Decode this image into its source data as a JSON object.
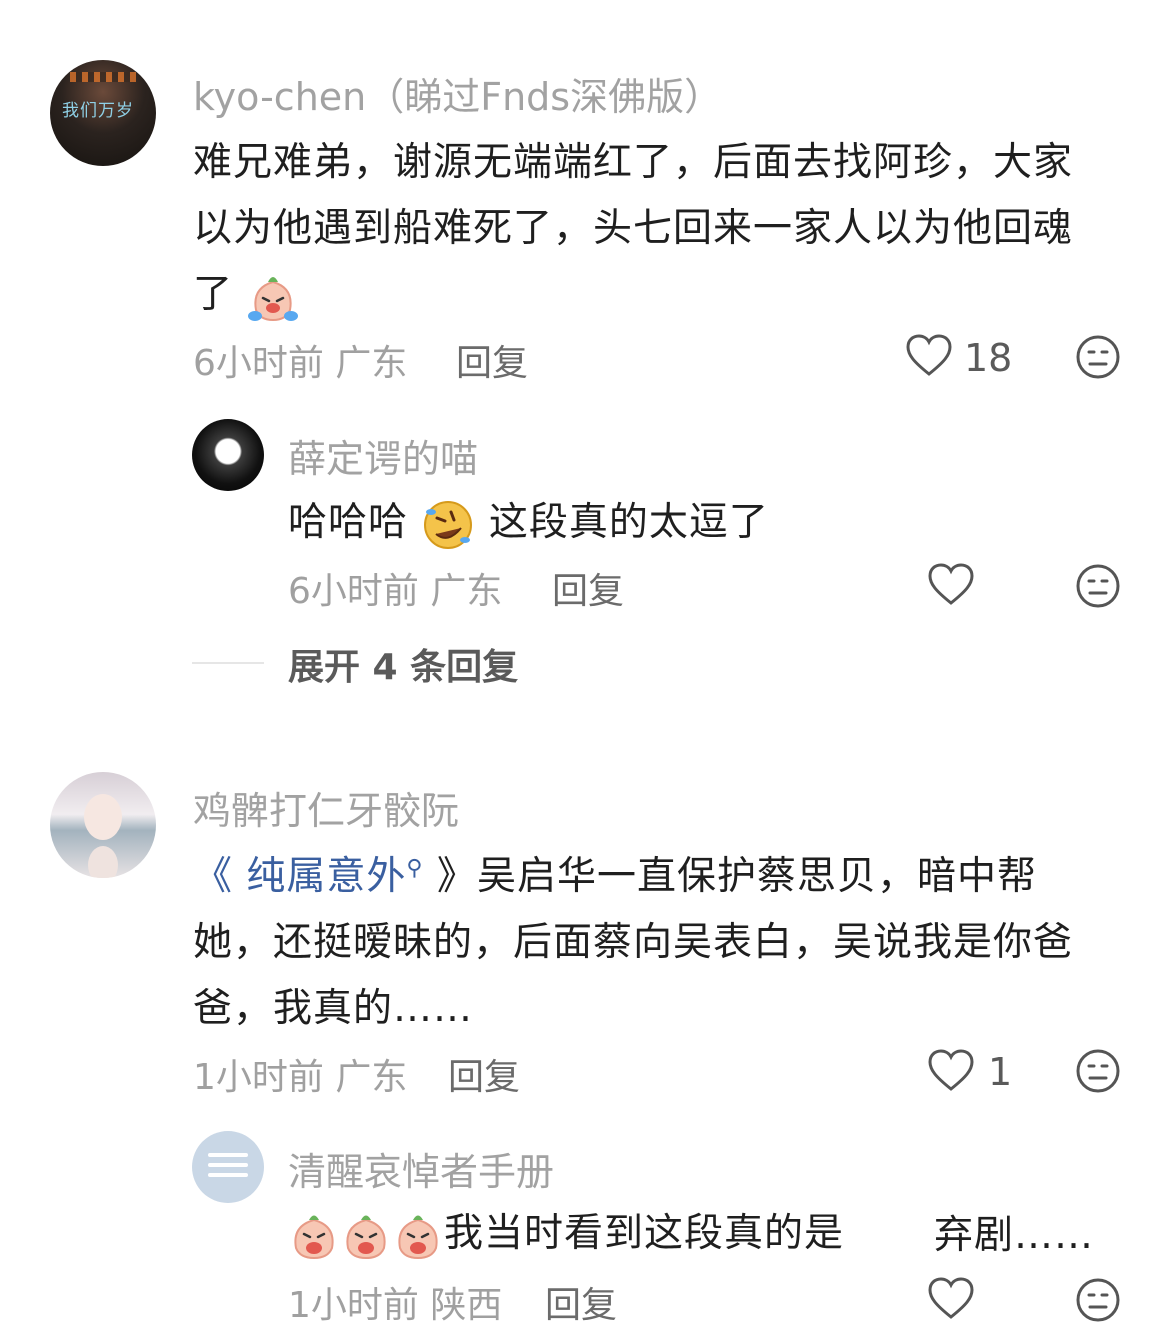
{
  "comments": [
    {
      "username": "kyo-chen（睇过Fnds深佛版）",
      "avatar_text": "我们万岁",
      "lines": [
        "难兄难弟，谢源无端端红了，后面去找阿珍，大家",
        "以为他遇到船难死了，头七回来一家人以为他回魂",
        "了"
      ],
      "time": "6小时前",
      "location": "广东",
      "reply_label": "回复",
      "likes": "18",
      "reply": {
        "username": "薛定谔的喵",
        "text_before": "哈哈哈",
        "text_after": "这段真的太逗了",
        "time": "6小时前",
        "location": "广东",
        "reply_label": "回复"
      },
      "expand_label": "展开 4 条回复"
    },
    {
      "username": "鸡髀打仁牙骹阮",
      "title_link": "《 纯属意外",
      "title_close": " 》",
      "lines": [
        "吴启华一直保护蔡思贝，暗中帮",
        "她，还挺暧昧的，后面蔡向吴表白，吴说我是你爸",
        "爸，我真的……"
      ],
      "time": "1小时前",
      "location": "广东",
      "reply_label": "回复",
      "likes": "1",
      "reply": {
        "username": "清醒哀悼者手册",
        "text": "我当时看到这段真的是",
        "text_tail": "弃剧……",
        "time": "1小时前",
        "location": "陕西",
        "reply_label": "回复"
      }
    }
  ],
  "icons": {
    "like": "heart-outline-icon",
    "dislike": "neutral-face-icon",
    "emoji_cry": "crying-laughing-emoji",
    "emoji_rofl": "rolling-laughing-emoji",
    "emoji_sob": "sobbing-emoji"
  }
}
